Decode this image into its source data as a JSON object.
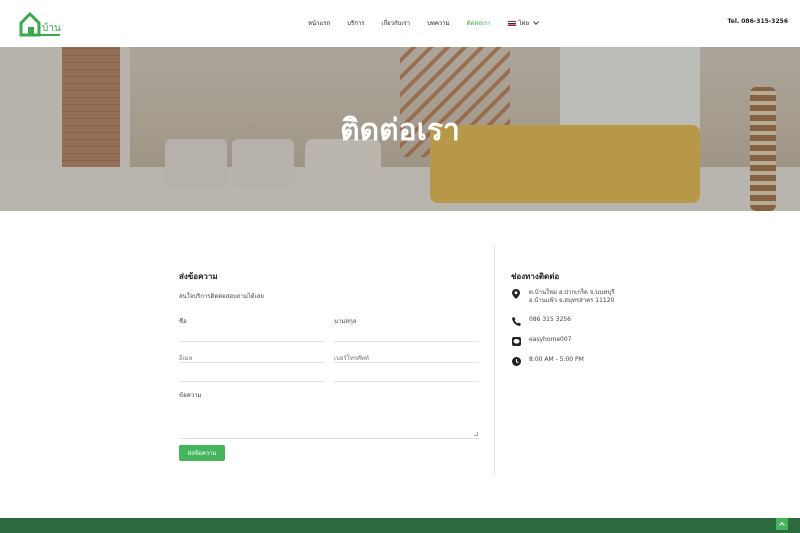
{
  "header": {
    "logo_text": "บ้าน",
    "nav": [
      "หน้าแรก",
      "บริการ",
      "เกี่ยวกับเรา",
      "บทความ",
      "ติดต่อเรา"
    ],
    "active_index": 4,
    "language": "ไทย",
    "tel": "Tel. 086-315-3256"
  },
  "hero": {
    "title": "ติดต่อเรา"
  },
  "form": {
    "title": "ส่งข้อความ",
    "subtitle": "สนใจบริการติดต่อสอบถามได้เลย",
    "name_label": "ชื่อ",
    "surname_label": "นามสกุล",
    "email_placeholder": "อีเมล",
    "phone_placeholder": "เบอร์โทรศัพท์",
    "message_label": "ข้อความ",
    "submit_label": "ส่งข้อความ"
  },
  "contact": {
    "title": "ช่องทางติดต่อ",
    "address": [
      "ต.บ้านใหม่ อ.ปากเกร็ด จ.นนทบุรี",
      "อ.บ้านแพ้ว จ.สมุทรสาคร 11120"
    ],
    "phone": "086 315 3256",
    "line": "easyhome007",
    "hours": "8:00 AM - 5:00 PM"
  },
  "colors": {
    "accent": "#46b35d",
    "footer": "#2d6a3e",
    "active_nav": "#3aaa4a"
  }
}
